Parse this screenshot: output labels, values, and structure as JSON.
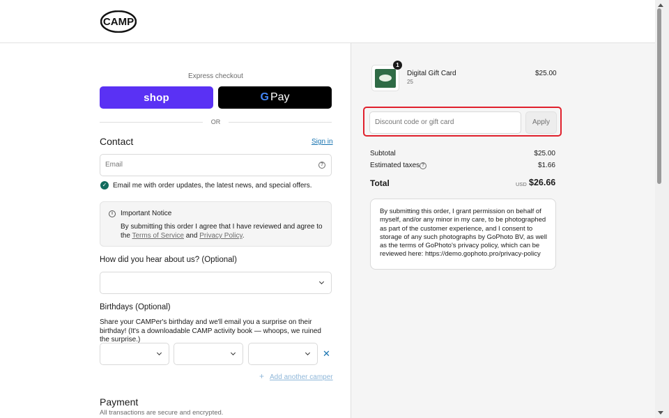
{
  "header": {
    "logo_text": "CAMP"
  },
  "express": {
    "label": "Express checkout",
    "shop_label": "shop",
    "gpay_g": "G",
    "gpay_label": "Pay",
    "or_text": "OR"
  },
  "contact": {
    "title": "Contact",
    "sign_in": "Sign in",
    "email_placeholder": "Email",
    "marketing_checked": true,
    "marketing_label": "Email me with order updates, the latest news, and special offers."
  },
  "notice": {
    "title": "Important Notice",
    "body_prefix": "By submitting this order I agree that I have reviewed and agree to the ",
    "terms_link": "Terms of Service",
    "and_text": " and ",
    "privacy_link": "Privacy Policy",
    "period": "."
  },
  "survey": {
    "title": "How did you hear about us? (Optional)",
    "selected": ""
  },
  "birthdays": {
    "title": "Birthdays (Optional)",
    "body": "Share your CAMPer's birthday and we'll email you a surprise on their birthday! (It's a downloadable CAMP activity book — whoops, we ruined the surprise.)",
    "add_camper": "Add another camper"
  },
  "payment": {
    "title": "Payment",
    "subtitle": "All transactions are secure and encrypted."
  },
  "order": {
    "item_name": "Digital Gift Card",
    "item_variant": "25",
    "item_qty": "1",
    "item_price": "$25.00",
    "discount_placeholder": "Discount code or gift card",
    "apply_label": "Apply",
    "subtotal_label": "Subtotal",
    "subtotal_value": "$25.00",
    "taxes_label": "Estimated taxes",
    "taxes_value": "$1.66",
    "total_label": "Total",
    "total_currency": "USD",
    "total_value": "$26.66",
    "consent_text": "By submitting this order, I grant permission on behalf of myself, and/or any minor in my care, to be photographed as part of the customer experience, and I consent to storage of any such photographs by GoPhoto BV, as well as the terms of GoPhoto's privacy policy, which can be reviewed here: https://demo.gophoto.pro/privacy-policy"
  },
  "colors": {
    "shop_purple": "#5a31f4",
    "checkbox_green": "#126c5e",
    "link_blue": "#1773b0",
    "highlight_red": "#e0202c"
  },
  "icons": {
    "help": "question-circle-icon",
    "info": "info-circle-icon",
    "chevron": "chevron-down-icon",
    "remove": "close-icon",
    "add": "plus-icon"
  }
}
